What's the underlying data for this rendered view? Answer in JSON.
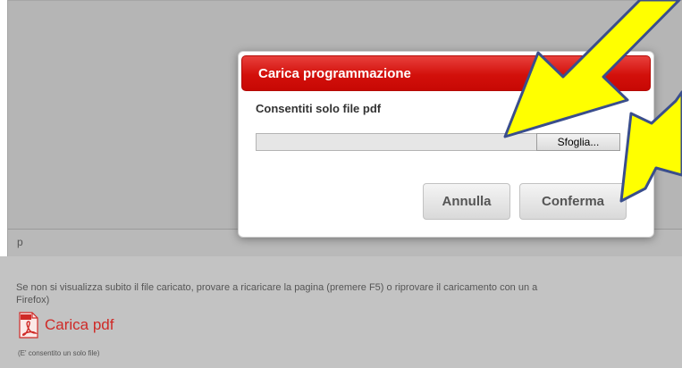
{
  "editor": {
    "status_text": "p"
  },
  "modal": {
    "title": "Carica programmazione",
    "subtitle": "Consentiti solo file pdf",
    "file_field_value": "",
    "browse_label": "Sfoglia...",
    "cancel_label": "Annulla",
    "confirm_label": "Conferma"
  },
  "page": {
    "info_line1": "Se non si visualizza subito il file caricato, provare a ricaricare la pagina (premere F5) o riprovare il caricamento con un a",
    "info_line2": "Firefox)",
    "pdf_link_label": "Carica pdf",
    "note": "(E' consentito un solo file)"
  },
  "colors": {
    "modal_header": "#d3100b",
    "arrow_fill": "#ffff00",
    "link": "#cf2a27"
  },
  "icons": {
    "pdf": "pdf-icon",
    "arrows": "annotation-arrow-icon"
  }
}
